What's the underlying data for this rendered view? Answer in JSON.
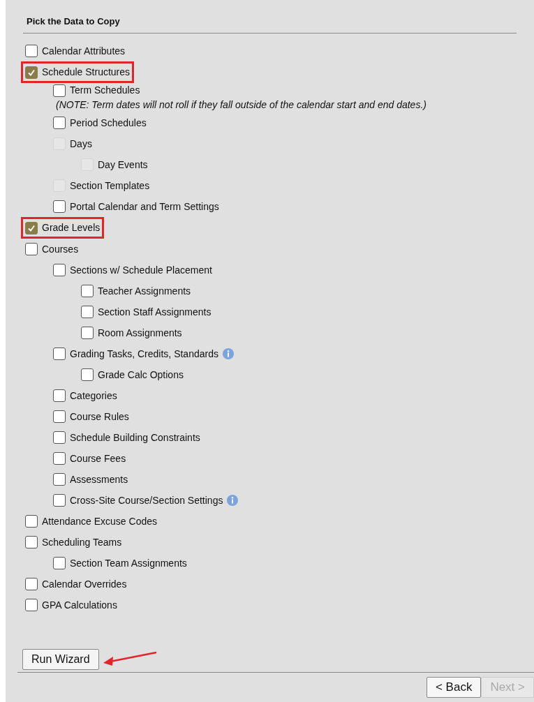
{
  "title": "Pick the Data to Copy",
  "items": [
    {
      "label": "Calendar Attributes",
      "checked": false,
      "disabled": false,
      "highlighted": false
    },
    {
      "label": "Schedule Structures",
      "checked": true,
      "disabled": false,
      "highlighted": true,
      "children": [
        {
          "label": "Term Schedules",
          "checked": false,
          "disabled": false,
          "highlighted": false,
          "note": "(NOTE: Term dates will not roll if they fall outside of the calendar start and end dates.)"
        },
        {
          "label": "Period Schedules",
          "checked": false,
          "disabled": false,
          "highlighted": false
        },
        {
          "label": "Days",
          "checked": false,
          "disabled": true,
          "highlighted": false,
          "children": [
            {
              "label": "Day Events",
              "checked": false,
              "disabled": true,
              "highlighted": false
            }
          ]
        },
        {
          "label": "Section Templates",
          "checked": false,
          "disabled": true,
          "highlighted": false
        },
        {
          "label": "Portal Calendar and Term Settings",
          "checked": false,
          "disabled": false,
          "highlighted": false
        }
      ]
    },
    {
      "label": "Grade Levels",
      "checked": true,
      "disabled": false,
      "highlighted": true
    },
    {
      "label": "Courses",
      "checked": false,
      "disabled": false,
      "highlighted": false,
      "children": [
        {
          "label": "Sections w/ Schedule Placement",
          "checked": false,
          "disabled": false,
          "highlighted": false,
          "children": [
            {
              "label": "Teacher Assignments",
              "checked": false,
              "disabled": false,
              "highlighted": false
            },
            {
              "label": "Section Staff Assignments",
              "checked": false,
              "disabled": false,
              "highlighted": false
            },
            {
              "label": "Room Assignments",
              "checked": false,
              "disabled": false,
              "highlighted": false
            }
          ]
        },
        {
          "label": "Grading Tasks, Credits, Standards",
          "checked": false,
          "disabled": false,
          "highlighted": false,
          "info": true,
          "children": [
            {
              "label": "Grade Calc Options",
              "checked": false,
              "disabled": false,
              "highlighted": false
            }
          ]
        },
        {
          "label": "Categories",
          "checked": false,
          "disabled": false,
          "highlighted": false
        },
        {
          "label": "Course Rules",
          "checked": false,
          "disabled": false,
          "highlighted": false
        },
        {
          "label": "Schedule Building Constraints",
          "checked": false,
          "disabled": false,
          "highlighted": false
        },
        {
          "label": "Course Fees",
          "checked": false,
          "disabled": false,
          "highlighted": false
        },
        {
          "label": "Assessments",
          "checked": false,
          "disabled": false,
          "highlighted": false
        },
        {
          "label": "Cross-Site Course/Section Settings",
          "checked": false,
          "disabled": false,
          "highlighted": false,
          "info": true
        }
      ]
    },
    {
      "label": "Attendance Excuse Codes",
      "checked": false,
      "disabled": false,
      "highlighted": false
    },
    {
      "label": "Scheduling Teams",
      "checked": false,
      "disabled": false,
      "highlighted": false,
      "children": [
        {
          "label": "Section Team Assignments",
          "checked": false,
          "disabled": false,
          "highlighted": false
        }
      ]
    },
    {
      "label": "Calendar Overrides",
      "checked": false,
      "disabled": false,
      "highlighted": false
    },
    {
      "label": "GPA Calculations",
      "checked": false,
      "disabled": false,
      "highlighted": false
    }
  ],
  "run_button": "Run Wizard",
  "back_button": {
    "label": "< Back",
    "disabled": false
  },
  "next_button": {
    "label": "Next >",
    "disabled": true
  }
}
